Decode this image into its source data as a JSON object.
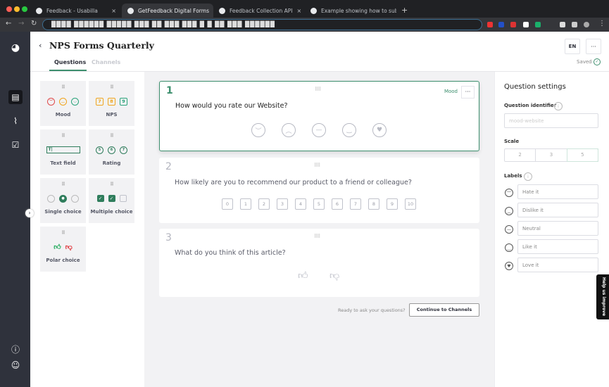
{
  "browser": {
    "tabs": [
      {
        "title": "Feedback - Usabilla"
      },
      {
        "title": "GetFeedback Digital Forms",
        "active": true
      },
      {
        "title": "Feedback Collection API"
      },
      {
        "title": "Example showing how to subm"
      }
    ],
    "close": "×",
    "new_tab": "+",
    "url": "████ ██████ █████ ███ ██ ███ ███ █ █ ██ ███ ██████"
  },
  "sidebar": {
    "items": [
      {
        "icon": "logo-icon"
      },
      {
        "icon": "forms-icon",
        "active": true
      },
      {
        "icon": "analytics-icon"
      },
      {
        "icon": "tasks-icon"
      },
      {
        "icon": "help-icon"
      },
      {
        "icon": "user-icon"
      }
    ]
  },
  "header": {
    "back": "‹",
    "title": "NPS Forms Quarterly",
    "tabs": [
      {
        "label": "Questions",
        "active": true
      },
      {
        "label": "Channels"
      }
    ],
    "language": "EN",
    "more": "···",
    "status": "Saved"
  },
  "palette": {
    "items": [
      {
        "label": "Mood"
      },
      {
        "label": "NPS"
      },
      {
        "label": "Text field"
      },
      {
        "label": "Rating"
      },
      {
        "label": "Single choice"
      },
      {
        "label": "Multiple choice"
      },
      {
        "label": "Polar choice"
      }
    ],
    "nps_nums": [
      "7",
      "8",
      "9"
    ],
    "rating_nums": [
      "5",
      "6",
      "7"
    ]
  },
  "questions": [
    {
      "number": "1",
      "text": "How would you rate our Website?",
      "type": "Mood",
      "selected": true
    },
    {
      "number": "2",
      "text": "How likely are you to recommend our product to a friend or colleague?",
      "scale": [
        "0",
        "1",
        "2",
        "3",
        "4",
        "5",
        "6",
        "7",
        "8",
        "9",
        "10"
      ]
    },
    {
      "number": "3",
      "text": "What do you think of this article?"
    }
  ],
  "footer": {
    "prompt": "Ready to ask your questions?",
    "button": "Continue to Channels"
  },
  "settings": {
    "title": "Question settings",
    "identifier_label": "Question identifier",
    "identifier_placeholder": "mood-website",
    "scale_label": "Scale",
    "scale_options": [
      "2",
      "3",
      "5"
    ],
    "scale_selected": "5",
    "labels_label": "Labels",
    "labels": [
      "Hate it",
      "Dislike it",
      "Neutral",
      "Like it",
      "Love it"
    ]
  },
  "feedback_tab": "Help us improve",
  "colors": {
    "accent": "#3d8f6e",
    "sidebar": "#2f323c",
    "canvas": "#f2f2f4"
  }
}
